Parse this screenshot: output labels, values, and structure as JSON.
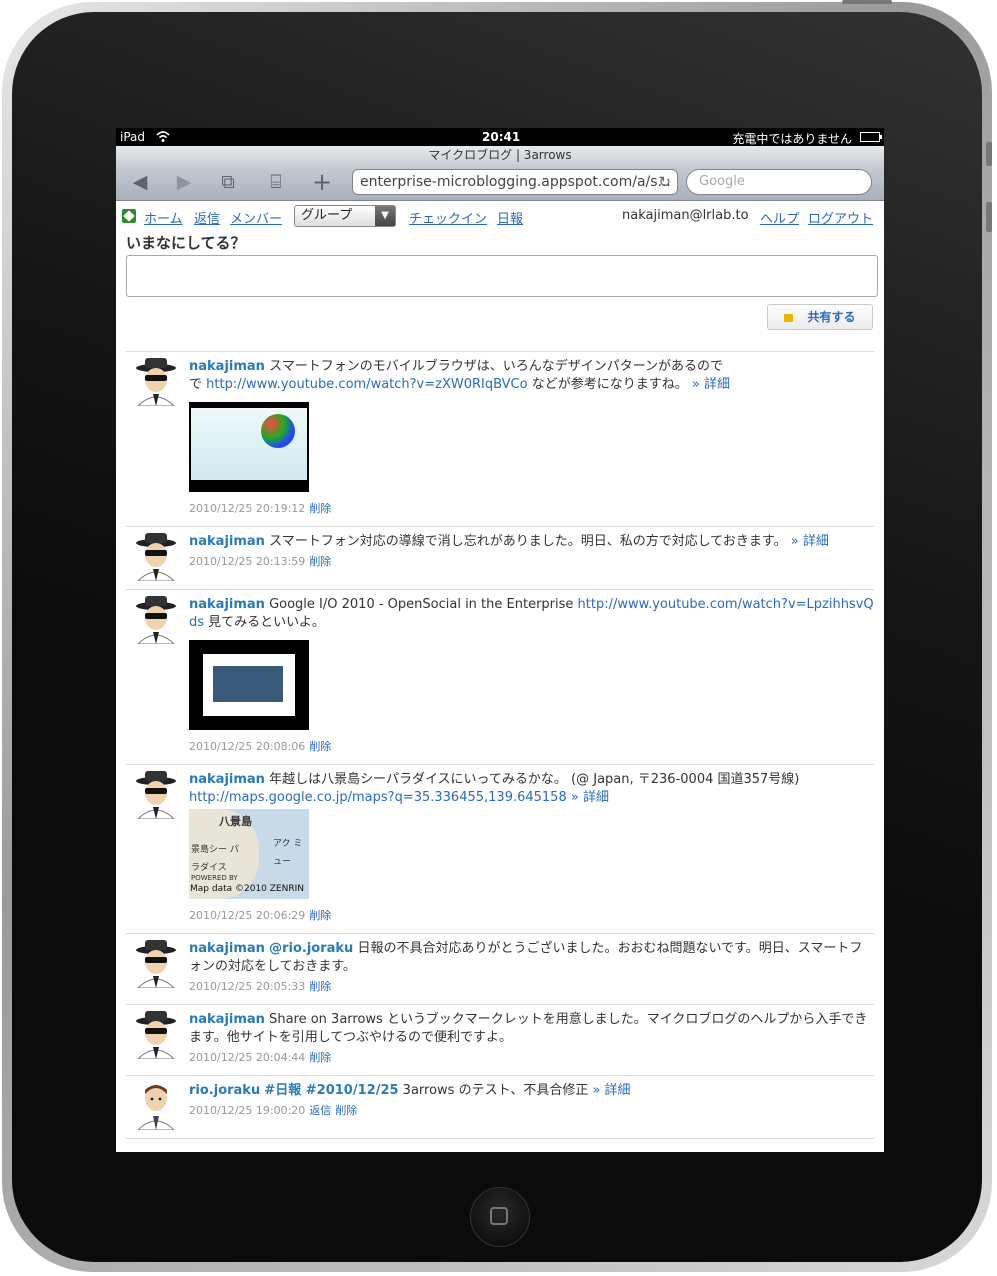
{
  "status_bar": {
    "device": "iPad",
    "time": "20:41",
    "charging": "充電中ではありません"
  },
  "browser": {
    "page_title": "マイクロブログ | 3arrows",
    "url": "enterprise-microblogging.appspot.com/a/s...",
    "search_placeholder": "Google",
    "icons": [
      "back-icon",
      "forward-icon",
      "pages-icon",
      "bookmarks-icon",
      "add-icon",
      "reload-icon"
    ]
  },
  "nav": {
    "home": "ホーム",
    "replies": "返信",
    "members": "メンバー",
    "group_selected": "グループ",
    "checkin": "チェックイン",
    "daily_report": "日報",
    "user_email": "nakajiman@lrlab.to",
    "help": "ヘルプ",
    "logout": "ログアウト"
  },
  "compose": {
    "prompt": "いまなにしてる？",
    "value": "",
    "share_button": "共有する"
  },
  "posts": [
    {
      "user": "nakajiman",
      "text_before": "スマートフォンのモバイルブラウザは、いろんなデザインパターンがあるので",
      "text_before2": "で",
      "link": "http://www.youtube.com/watch?v=zXW0RIqBVCo",
      "text_after": "などが参考になりますね。",
      "detail": "» 詳細",
      "timestamp": "2010/12/25 20:19:12",
      "action": "削除"
    },
    {
      "user": "nakajiman",
      "text": "スマートフォン対応の導線で消し忘れがありました。明日、私の方で対応しておきます。",
      "detail": "» 詳細",
      "timestamp": "2010/12/25 20:13:59",
      "action": "削除"
    },
    {
      "user": "nakajiman",
      "text_before": "Google I/O 2010 - OpenSocial in the Enterprise",
      "link": "http://www.youtube.com/watch?v=LpzihhsvQds",
      "text_after": "見てみるといいよ。",
      "timestamp": "2010/12/25 20:08:06",
      "action": "削除"
    },
    {
      "user": "nakajiman",
      "text_before": "年越しは八景島シーパラダイスにいってみるかな。 (@ Japan, 〒236-0004 国道357号線)",
      "link": "http://maps.google.co.jp/maps?q=35.336455,139.645158",
      "detail": "» 詳細",
      "map_label1": "八景島",
      "map_label2": "景島シー パラダイス",
      "map_label3": "アク ミュー",
      "map_powered": "POWERED BY",
      "map_credit": "Map data ©2010 ZENRIN",
      "timestamp": "2010/12/25 20:06:29",
      "action": "削除"
    },
    {
      "user": "nakajiman",
      "mention": "@rio.joraku",
      "text": "日報の不具合対応ありがとうございました。おおむね問題ないです。明日、スマートフォンの対応をしておきます。",
      "timestamp": "2010/12/25 20:05:33",
      "action": "削除"
    },
    {
      "user": "nakajiman",
      "text": "Share on 3arrows というブックマークレットを用意しました。マイクロブログのヘルプから入手できます。他サイトを引用してつぶやけるので便利ですよ。",
      "timestamp": "2010/12/25 20:04:44",
      "action": "削除"
    },
    {
      "user": "rio.joraku",
      "tags": "#日報 #2010/12/25",
      "text": "3arrows のテスト、不具合修正",
      "detail": "» 詳細",
      "timestamp": "2010/12/25 19:00:20",
      "reply": "返信",
      "action": "削除"
    }
  ]
}
